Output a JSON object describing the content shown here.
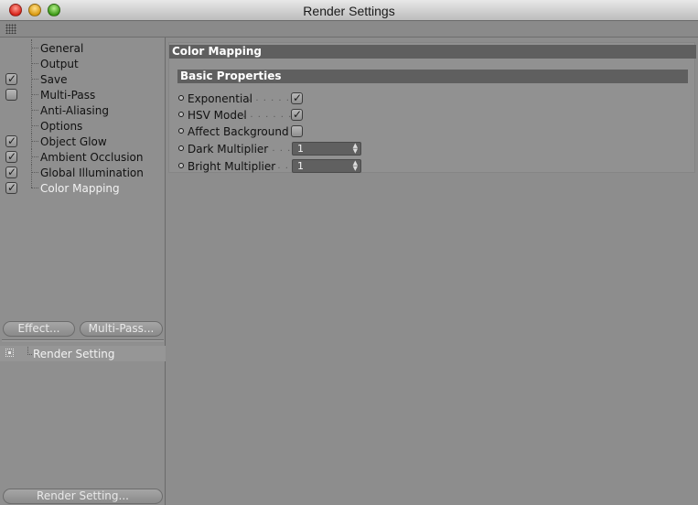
{
  "window": {
    "title": "Render Settings"
  },
  "sidebar": {
    "items": [
      {
        "label": "General",
        "checkbox": "none"
      },
      {
        "label": "Output",
        "checkbox": "none"
      },
      {
        "label": "Save",
        "checkbox": "checked"
      },
      {
        "label": "Multi-Pass",
        "checkbox": "unchecked"
      },
      {
        "label": "Anti-Aliasing",
        "checkbox": "none"
      },
      {
        "label": "Options",
        "checkbox": "none"
      },
      {
        "label": "Object Glow",
        "checkbox": "checked"
      },
      {
        "label": "Ambient Occlusion",
        "checkbox": "checked"
      },
      {
        "label": "Global Illumination",
        "checkbox": "checked"
      },
      {
        "label": "Color Mapping",
        "checkbox": "checked",
        "active": true
      }
    ],
    "effect_button": "Effect...",
    "multipass_button": "Multi-Pass...",
    "render_setting_item": "Render Setting",
    "render_setting_button": "Render Setting..."
  },
  "main": {
    "section_title": "Color Mapping",
    "group_title": "Basic Properties",
    "properties": {
      "exponential": {
        "label": "Exponential",
        "checked": true
      },
      "hsv_model": {
        "label": "HSV Model",
        "checked": true
      },
      "affect_background": {
        "label": "Affect Background",
        "checked": false
      },
      "dark_multiplier": {
        "label": "Dark Multiplier",
        "value": "1"
      },
      "bright_multiplier": {
        "label": "Bright Multiplier",
        "value": "1"
      }
    }
  },
  "colors": {
    "background": "#8d8d8d",
    "header": "#5f5f5f",
    "active_text": "#f2f2f2"
  }
}
